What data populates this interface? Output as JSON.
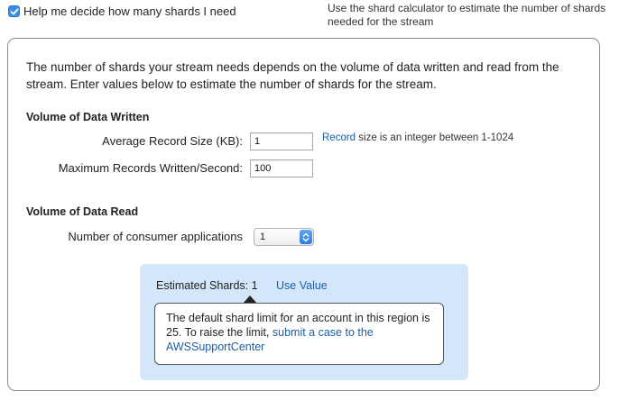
{
  "checkbox": {
    "label": "Help me decide how many shards I need",
    "checked": true
  },
  "hint": "Use the shard calculator to estimate the number of shards needed for the stream",
  "intro": "The number of shards your stream needs depends on the volume of data written and read from the stream. Enter values below to estimate the number of shards for the stream.",
  "written": {
    "title": "Volume of Data Written",
    "avg_record_label": "Average Record Size (KB):",
    "avg_record_value": "1",
    "max_records_label": "Maximum Records Written/Second:",
    "max_records_value": "100",
    "record_link": "Record",
    "record_hint": " size is an integer between 1-1024"
  },
  "read": {
    "title": "Volume of Data Read",
    "consumers_label": "Number of consumer applications",
    "consumers_value": "1"
  },
  "estimate": {
    "label": "Estimated Shards: 1",
    "use_value": "Use Value",
    "tooltip_text": "The default shard limit for an account in this region is 25. To raise the limit, ",
    "tooltip_link": "submit a case to the AWSSupportCenter"
  },
  "colors": {
    "accent": "#3b8fe6",
    "link": "#1d5ca8",
    "estimate_bg": "#d4e7fa"
  },
  "icons": {
    "checkbox": "checkmark-icon",
    "select": "chevron-updown-icon"
  }
}
